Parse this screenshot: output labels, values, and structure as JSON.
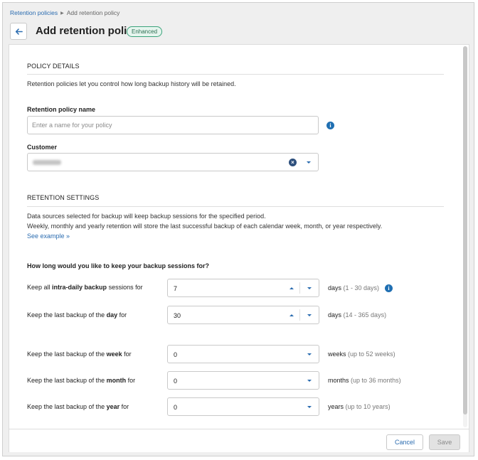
{
  "breadcrumb": {
    "parent": "Retention policies",
    "current": "Add retention policy"
  },
  "header": {
    "title": "Add retention policy",
    "badge": "Enhanced"
  },
  "policy_details": {
    "title": "POLICY DETAILS",
    "description": "Retention policies let you control how long backup history will be retained.",
    "name_label": "Retention policy name",
    "name_placeholder": "Enter a name for your policy",
    "name_value": "",
    "customer_label": "Customer"
  },
  "retention_settings": {
    "title": "RETENTION SETTINGS",
    "description_1": "Data sources selected for backup will keep backup sessions for the specified period.",
    "description_2": "Weekly, monthly and yearly retention will store the last successful backup of each calendar week, month, or year respectively.",
    "see_example": "See example »",
    "question": "How long would you like to keep your backup sessions for?",
    "rows": [
      {
        "label_pre": "Keep all ",
        "label_bold": "intra-daily backup",
        "label_post": " sessions for",
        "value": "7",
        "unit": "days",
        "range": "(1 - 30 days)"
      },
      {
        "label_pre": "Keep the last backup of the ",
        "label_bold": "day",
        "label_post": " for",
        "value": "30",
        "unit": "days",
        "range": "(14 - 365 days)"
      },
      {
        "label_pre": "Keep the last backup of the ",
        "label_bold": "week",
        "label_post": " for",
        "value": "0",
        "unit": "weeks",
        "range": "(up to 52 weeks)"
      },
      {
        "label_pre": "Keep the last backup of the ",
        "label_bold": "month",
        "label_post": " for",
        "value": "0",
        "unit": "months",
        "range": "(up to 36 months)"
      },
      {
        "label_pre": "Keep the last backup of the ",
        "label_bold": "year",
        "label_post": " for",
        "value": "0",
        "unit": "years",
        "range": "(up to 10 years)"
      }
    ]
  },
  "footer": {
    "cancel": "Cancel",
    "save": "Save"
  },
  "colors": {
    "link": "#2b6cb0",
    "badge_border": "#3aa37a",
    "info": "#1f6fb2"
  },
  "icons": {
    "back": "arrow-left-icon",
    "info": "info-icon",
    "clear": "clear-circle-icon"
  }
}
